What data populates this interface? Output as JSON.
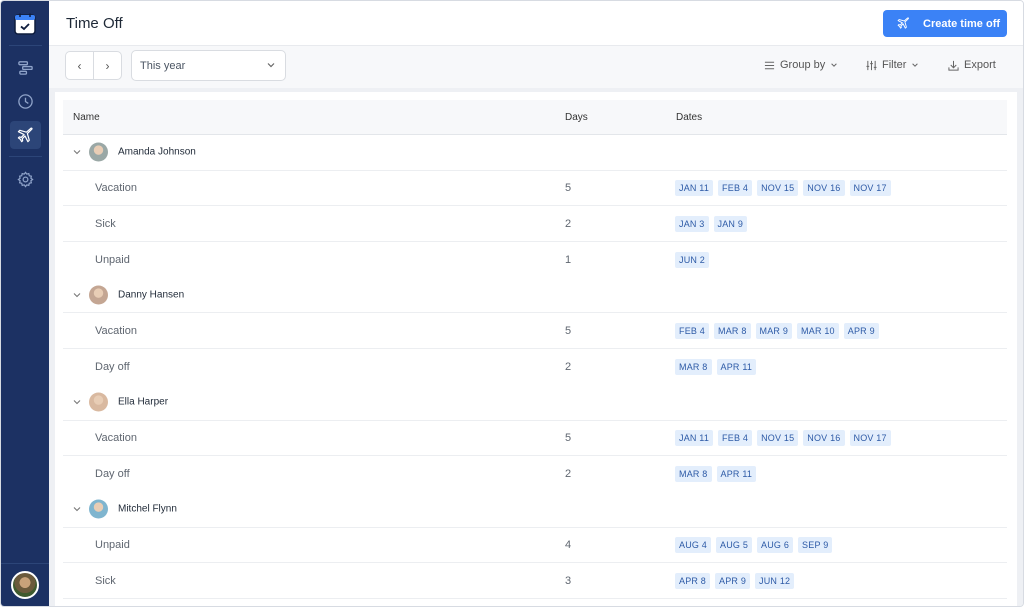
{
  "app": {
    "title": "Time Off",
    "create_button": "Create time off"
  },
  "sidebar": {
    "items": [
      {
        "name": "timeline",
        "icon": "timeline-icon"
      },
      {
        "name": "clock",
        "icon": "clock-icon"
      },
      {
        "name": "time-off",
        "icon": "airplane-icon",
        "active": true
      },
      {
        "name": "settings",
        "icon": "gear-icon"
      }
    ]
  },
  "toolbar": {
    "prev": "‹",
    "next": "›",
    "period": "This year",
    "group_by": "Group by",
    "filter": "Filter",
    "export": "Export"
  },
  "table": {
    "columns": {
      "name": "Name",
      "days": "Days",
      "dates": "Dates"
    },
    "groups": [
      {
        "person": "Amanda Johnson",
        "avatar_color": "#9aa8a6",
        "entries": [
          {
            "type": "Vacation",
            "days": "5",
            "dates": [
              "JAN 11",
              "FEB 4",
              "NOV 15",
              "NOV 16",
              "NOV 17"
            ]
          },
          {
            "type": "Sick",
            "days": "2",
            "dates": [
              "JAN 3",
              "JAN 9"
            ]
          },
          {
            "type": "Unpaid",
            "days": "1",
            "dates": [
              "JUN 2"
            ]
          }
        ]
      },
      {
        "person": "Danny Hansen",
        "avatar_color": "#c4a693",
        "entries": [
          {
            "type": "Vacation",
            "days": "5",
            "dates": [
              "FEB 4",
              "MAR 8",
              "MAR 9",
              "MAR 10",
              "APR 9"
            ]
          },
          {
            "type": "Day off",
            "days": "2",
            "dates": [
              "MAR 8",
              "APR 11"
            ]
          }
        ]
      },
      {
        "person": "Ella Harper",
        "avatar_color": "#d9b9a0",
        "entries": [
          {
            "type": "Vacation",
            "days": "5",
            "dates": [
              "JAN 11",
              "FEB 4",
              "NOV 15",
              "NOV 16",
              "NOV 17"
            ]
          },
          {
            "type": "Day off",
            "days": "2",
            "dates": [
              "MAR 8",
              "APR 11"
            ]
          }
        ]
      },
      {
        "person": "Mitchel Flynn",
        "avatar_color": "#7fb5cf",
        "entries": [
          {
            "type": "Unpaid",
            "days": "4",
            "dates": [
              "AUG 4",
              "AUG 5",
              "AUG 6",
              "SEP 9"
            ]
          },
          {
            "type": "Sick",
            "days": "3",
            "dates": [
              "APR 8",
              "APR 9",
              "JUN 12"
            ]
          }
        ]
      }
    ]
  },
  "colors": {
    "sidebar": "#1c3163",
    "accent": "#3b82f6",
    "tag_bg": "#e3eefc",
    "tag_text": "#2d5aa6"
  }
}
